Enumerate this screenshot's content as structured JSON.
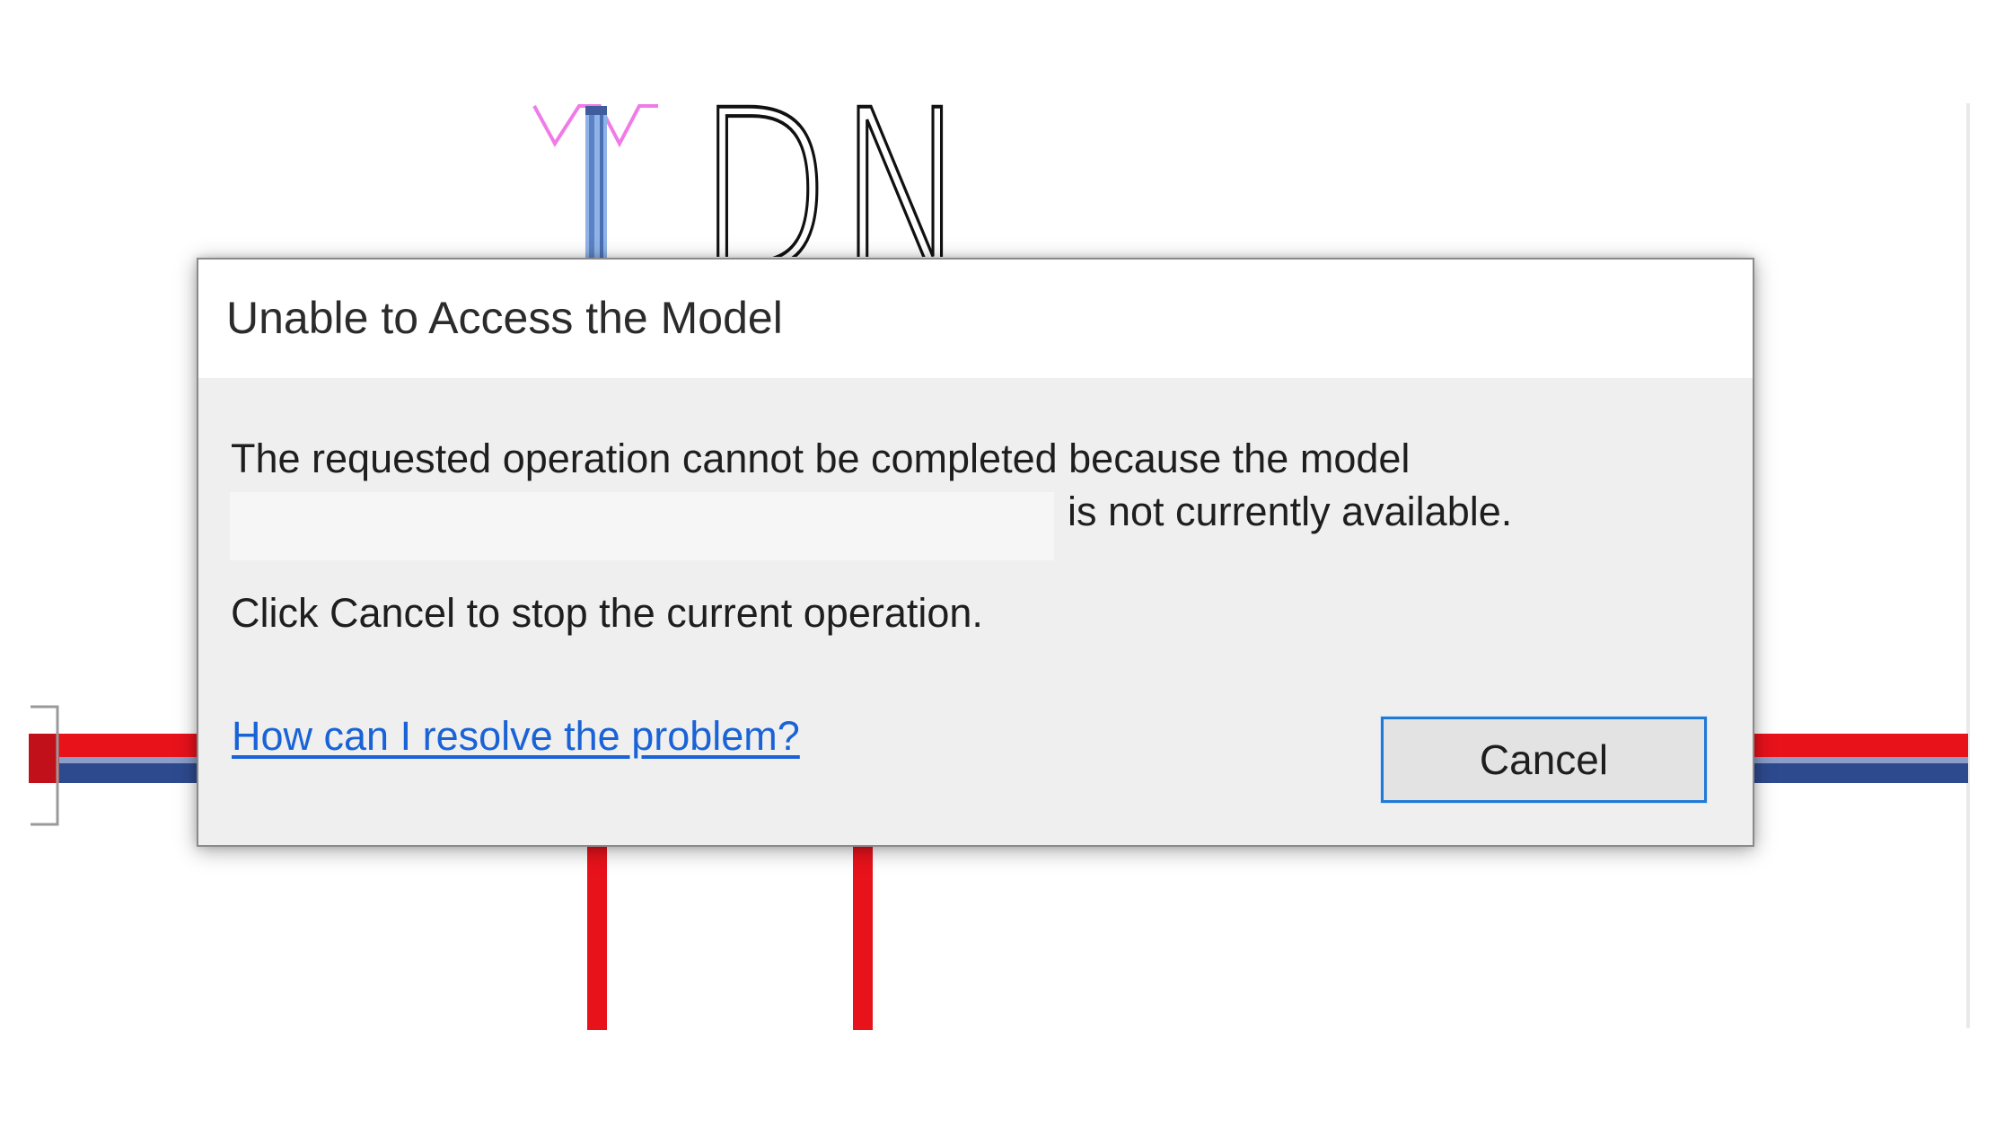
{
  "dialog": {
    "title": "Unable to Access the Model",
    "message_line_1": "The requested operation cannot be completed because the model",
    "message_line_2": "is not currently available.",
    "message_line_3": "Click Cancel to stop the current operation.",
    "help_link": "How can I resolve the problem?",
    "cancel_label": "Cancel"
  },
  "drawing": {
    "label": "DN"
  },
  "colors": {
    "supply_pipe": "#e8121b",
    "return_pipe": "#2e4a8f",
    "vertical_pipe": "#7fa8e0",
    "link": "#1a63d6",
    "button_focus_border": "#1f7ad6"
  },
  "icons": {
    "pipe_symbol": "magenta-v-zigzag"
  }
}
